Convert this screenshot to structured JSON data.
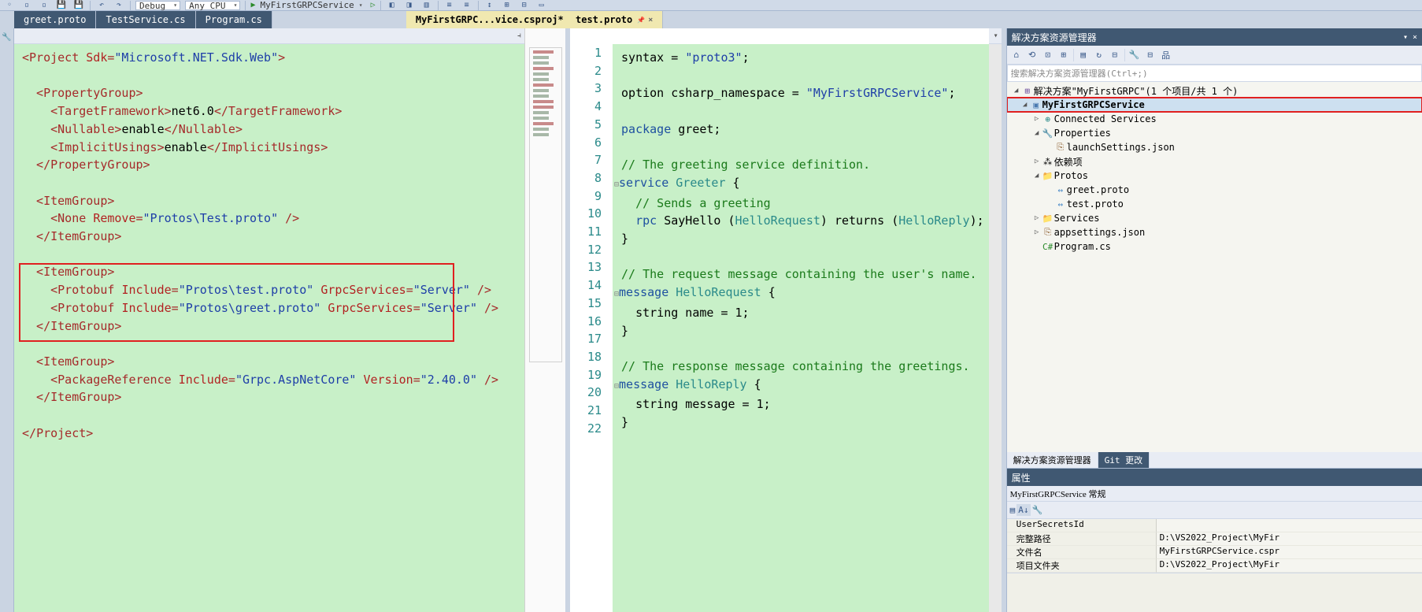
{
  "toolbar": {
    "config": "Debug",
    "platform": "Any CPU",
    "project": "MyFirstGRPCService"
  },
  "tabs": {
    "left": [
      {
        "label": "greet.proto"
      },
      {
        "label": "TestService.cs"
      },
      {
        "label": "Program.cs"
      },
      {
        "label": "MyFirstGRPC...vice.csproj*"
      }
    ],
    "right": [
      {
        "label": "test.proto"
      }
    ]
  },
  "editor_left": {
    "lines": [
      {
        "t": "tag",
        "content": "<Project Sdk=\"Microsoft.NET.Sdk.Web\">",
        "parts": [
          [
            "<",
            "tag"
          ],
          [
            "Project ",
            "tag"
          ],
          [
            "Sdk",
            "attr"
          ],
          [
            "=",
            "tag"
          ],
          [
            "\"Microsoft.NET.Sdk.Web\"",
            "str"
          ],
          [
            ">",
            "tag"
          ]
        ]
      },
      {
        "blank": true
      },
      {
        "parts": [
          [
            "  <",
            "tag"
          ],
          [
            "PropertyGroup",
            "tag"
          ],
          [
            ">",
            "tag"
          ]
        ]
      },
      {
        "parts": [
          [
            "    <",
            "tag"
          ],
          [
            "TargetFramework",
            "tag"
          ],
          [
            ">",
            "tag"
          ],
          [
            "net6.0",
            "txt"
          ],
          [
            "</",
            "tag"
          ],
          [
            "TargetFramework",
            "tag"
          ],
          [
            ">",
            "tag"
          ]
        ]
      },
      {
        "parts": [
          [
            "    <",
            "tag"
          ],
          [
            "Nullable",
            "tag"
          ],
          [
            ">",
            "tag"
          ],
          [
            "enable",
            "txt"
          ],
          [
            "</",
            "tag"
          ],
          [
            "Nullable",
            "tag"
          ],
          [
            ">",
            "tag"
          ]
        ]
      },
      {
        "parts": [
          [
            "    <",
            "tag"
          ],
          [
            "ImplicitUsings",
            "tag"
          ],
          [
            ">",
            "tag"
          ],
          [
            "enable",
            "txt"
          ],
          [
            "</",
            "tag"
          ],
          [
            "ImplicitUsings",
            "tag"
          ],
          [
            ">",
            "tag"
          ]
        ]
      },
      {
        "parts": [
          [
            "  </",
            "tag"
          ],
          [
            "PropertyGroup",
            "tag"
          ],
          [
            ">",
            "tag"
          ]
        ]
      },
      {
        "blank": true
      },
      {
        "parts": [
          [
            "  <",
            "tag"
          ],
          [
            "ItemGroup",
            "tag"
          ],
          [
            ">",
            "tag"
          ]
        ]
      },
      {
        "parts": [
          [
            "    <",
            "tag"
          ],
          [
            "None ",
            "tag"
          ],
          [
            "Remove",
            "attr"
          ],
          [
            "=",
            "tag"
          ],
          [
            "\"Protos\\Test.proto\"",
            "str"
          ],
          [
            " />",
            "tag"
          ]
        ]
      },
      {
        "parts": [
          [
            "  </",
            "tag"
          ],
          [
            "ItemGroup",
            "tag"
          ],
          [
            ">",
            "tag"
          ]
        ]
      },
      {
        "blank": true
      },
      {
        "parts": [
          [
            "  <",
            "tag"
          ],
          [
            "ItemGroup",
            "tag"
          ],
          [
            ">",
            "tag"
          ]
        ]
      },
      {
        "parts": [
          [
            "    <",
            "tag"
          ],
          [
            "Protobuf ",
            "tag"
          ],
          [
            "Include",
            "attr"
          ],
          [
            "=",
            "tag"
          ],
          [
            "\"Protos\\test.proto\"",
            "str"
          ],
          [
            " ",
            "tag"
          ],
          [
            "GrpcServices",
            "attr"
          ],
          [
            "=",
            "tag"
          ],
          [
            "\"Server\"",
            "str"
          ],
          [
            " />",
            "tag"
          ]
        ]
      },
      {
        "parts": [
          [
            "    <",
            "tag"
          ],
          [
            "Protobuf ",
            "tag"
          ],
          [
            "Include",
            "attr"
          ],
          [
            "=",
            "tag"
          ],
          [
            "\"Protos\\greet.proto\"",
            "str"
          ],
          [
            " ",
            "tag"
          ],
          [
            "GrpcServices",
            "attr"
          ],
          [
            "=",
            "tag"
          ],
          [
            "\"Server\"",
            "str"
          ],
          [
            " />",
            "tag"
          ]
        ]
      },
      {
        "parts": [
          [
            "  </",
            "tag"
          ],
          [
            "ItemGroup",
            "tag"
          ],
          [
            ">",
            "tag"
          ]
        ]
      },
      {
        "blank": true
      },
      {
        "parts": [
          [
            "  <",
            "tag"
          ],
          [
            "ItemGroup",
            "tag"
          ],
          [
            ">",
            "tag"
          ]
        ]
      },
      {
        "parts": [
          [
            "    <",
            "tag"
          ],
          [
            "PackageReference ",
            "tag"
          ],
          [
            "Include",
            "attr"
          ],
          [
            "=",
            "tag"
          ],
          [
            "\"Grpc.AspNetCore\"",
            "str"
          ],
          [
            " ",
            "tag"
          ],
          [
            "Version",
            "attr"
          ],
          [
            "=",
            "tag"
          ],
          [
            "\"2.40.0\"",
            "str"
          ],
          [
            " />",
            "tag"
          ]
        ]
      },
      {
        "parts": [
          [
            "  </",
            "tag"
          ],
          [
            "ItemGroup",
            "tag"
          ],
          [
            ">",
            "tag"
          ]
        ]
      },
      {
        "blank": true
      },
      {
        "parts": [
          [
            "</",
            "tag"
          ],
          [
            "Project",
            "tag"
          ],
          [
            ">",
            "tag"
          ]
        ]
      }
    ]
  },
  "editor_right": {
    "lines": [
      {
        "n": 1,
        "parts": [
          [
            "syntax = ",
            "txt"
          ],
          [
            "\"proto3\"",
            "str"
          ],
          [
            ";",
            "txt"
          ]
        ]
      },
      {
        "n": 2,
        "blank": true
      },
      {
        "n": 3,
        "parts": [
          [
            "option csharp_namespace = ",
            "txt"
          ],
          [
            "\"MyFirstGRPCService\"",
            "str"
          ],
          [
            ";",
            "txt"
          ]
        ]
      },
      {
        "n": 4,
        "blank": true
      },
      {
        "n": 5,
        "parts": [
          [
            "package ",
            "kw"
          ],
          [
            "greet;",
            "txt"
          ]
        ]
      },
      {
        "n": 6,
        "blank": true
      },
      {
        "n": 7,
        "parts": [
          [
            "// The greeting service definition.",
            "cmt"
          ]
        ]
      },
      {
        "n": 8,
        "fold": true,
        "parts": [
          [
            "service ",
            "kw"
          ],
          [
            "Greeter ",
            "typ"
          ],
          [
            "{",
            "txt"
          ]
        ]
      },
      {
        "n": 9,
        "parts": [
          [
            "  ",
            "txt"
          ],
          [
            "// Sends a greeting",
            "cmt"
          ]
        ]
      },
      {
        "n": 10,
        "parts": [
          [
            "  rpc ",
            "kw"
          ],
          [
            "SayHello ",
            "txt"
          ],
          [
            "(",
            "txt"
          ],
          [
            "HelloRequest",
            "typ"
          ],
          [
            ") returns (",
            "txt"
          ],
          [
            "HelloReply",
            "typ"
          ],
          [
            ");",
            "txt"
          ]
        ]
      },
      {
        "n": 11,
        "parts": [
          [
            "}",
            "txt"
          ]
        ]
      },
      {
        "n": 12,
        "blank": true
      },
      {
        "n": 13,
        "parts": [
          [
            "// The request message containing the user's name.",
            "cmt"
          ]
        ]
      },
      {
        "n": 14,
        "fold": true,
        "parts": [
          [
            "message ",
            "kw"
          ],
          [
            "HelloRequest ",
            "typ"
          ],
          [
            "{",
            "txt"
          ]
        ]
      },
      {
        "n": 15,
        "parts": [
          [
            "  string name = 1;",
            "txt"
          ]
        ]
      },
      {
        "n": 16,
        "parts": [
          [
            "}",
            "txt"
          ]
        ]
      },
      {
        "n": 17,
        "blank": true
      },
      {
        "n": 18,
        "parts": [
          [
            "// The response message containing the greetings.",
            "cmt"
          ]
        ]
      },
      {
        "n": 19,
        "fold": true,
        "parts": [
          [
            "message ",
            "kw"
          ],
          [
            "HelloReply ",
            "typ"
          ],
          [
            "{",
            "txt"
          ]
        ]
      },
      {
        "n": 20,
        "parts": [
          [
            "  string message = 1;",
            "txt"
          ]
        ]
      },
      {
        "n": 21,
        "parts": [
          [
            "}",
            "txt"
          ]
        ]
      },
      {
        "n": 22,
        "blank": true
      }
    ]
  },
  "solution": {
    "title": "解决方案资源管理器",
    "search_placeholder": "搜索解决方案资源管理器(Ctrl+;)",
    "root": "解决方案\"MyFirstGRPC\"(1 个项目/共 1 个)",
    "project": "MyFirstGRPCService",
    "nodes": {
      "connected": "Connected Services",
      "properties": "Properties",
      "launch": "launchSettings.json",
      "deps": "依赖项",
      "protos": "Protos",
      "greet": "greet.proto",
      "test": "test.proto",
      "services": "Services",
      "appsettings": "appsettings.json",
      "program": "Program.cs"
    },
    "tabs": {
      "active": "解决方案资源管理器",
      "other": "Git 更改"
    }
  },
  "properties": {
    "title": "属性",
    "object": "MyFirstGRPCService 常规",
    "rows": [
      {
        "k": "UserSecretsId",
        "v": ""
      },
      {
        "k": "完整路径",
        "v": "D:\\VS2022_Project\\MyFir"
      },
      {
        "k": "文件名",
        "v": "MyFirstGRPCService.cspr"
      },
      {
        "k": "项目文件夹",
        "v": "D:\\VS2022_Project\\MyFir"
      }
    ]
  }
}
